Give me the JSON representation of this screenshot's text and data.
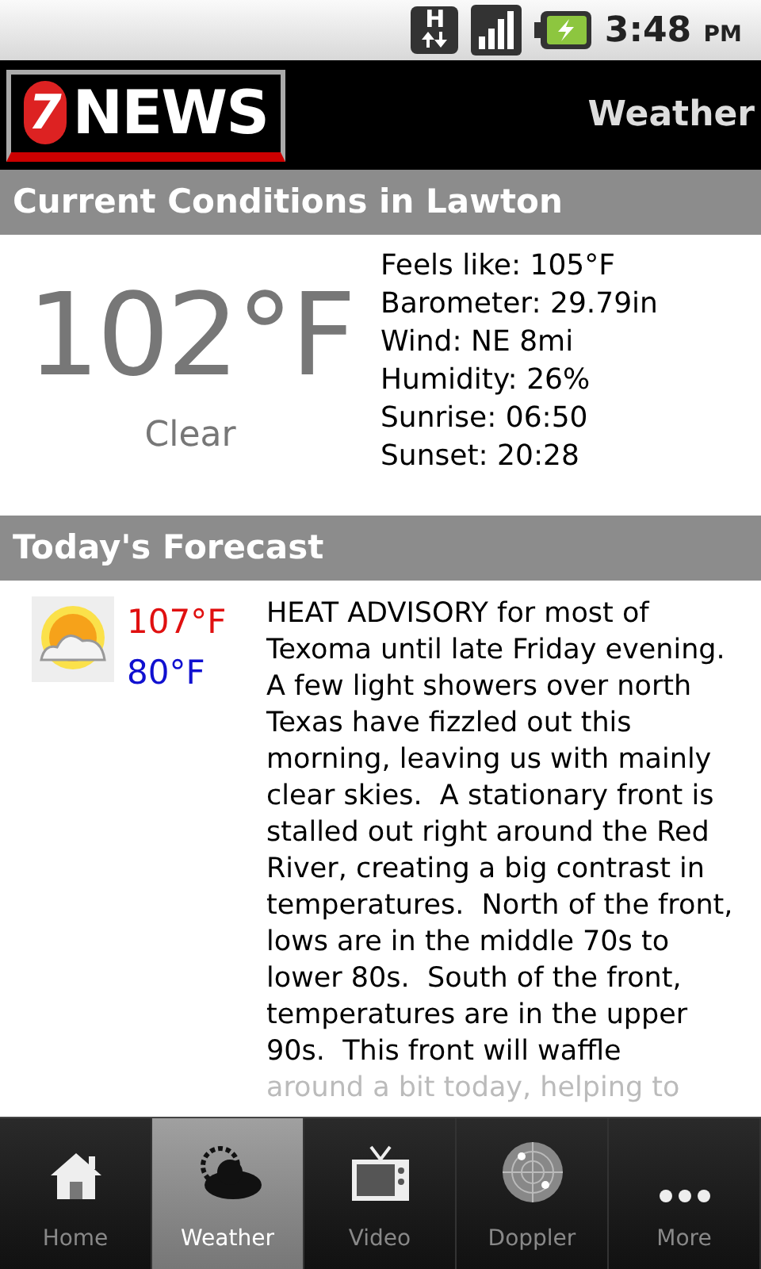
{
  "status_bar": {
    "time": "3:48",
    "ampm": "PM",
    "network": "H"
  },
  "header": {
    "logo_number": "7",
    "logo_word": "NEWS",
    "title": "Weather"
  },
  "current": {
    "heading": "Current Conditions in Lawton",
    "temperature": "102°F",
    "condition": "Clear",
    "details": [
      "Feels like: 105°F",
      "Barometer: 29.79in",
      "Wind: NE 8mi",
      "Humidity: 26%",
      "Sunrise: 06:50",
      "Sunset: 20:28"
    ]
  },
  "forecast": {
    "heading": "Today's Forecast",
    "high": "107°F",
    "low": "80°F",
    "text": "HEAT ADVISORY for most of Texoma until late Friday evening.  A few light showers over north Texas have fizzled out this morning, leaving us with mainly clear skies.  A stationary front is stalled out right around the Red River, creating a big contrast in temperatures.  North of the front, lows are in the middle 70s to lower 80s.  South of the front, temperatures are in the upper 90s.  This front will waffle",
    "faded_text": "around a bit today, helping to"
  },
  "tabs": [
    {
      "label": "Home",
      "kind": "home",
      "selected": false
    },
    {
      "label": "Weather",
      "kind": "weather",
      "selected": true
    },
    {
      "label": "Video",
      "kind": "video",
      "selected": false
    },
    {
      "label": "Doppler",
      "kind": "doppler",
      "selected": false
    },
    {
      "label": "More",
      "kind": "more",
      "selected": false
    }
  ]
}
